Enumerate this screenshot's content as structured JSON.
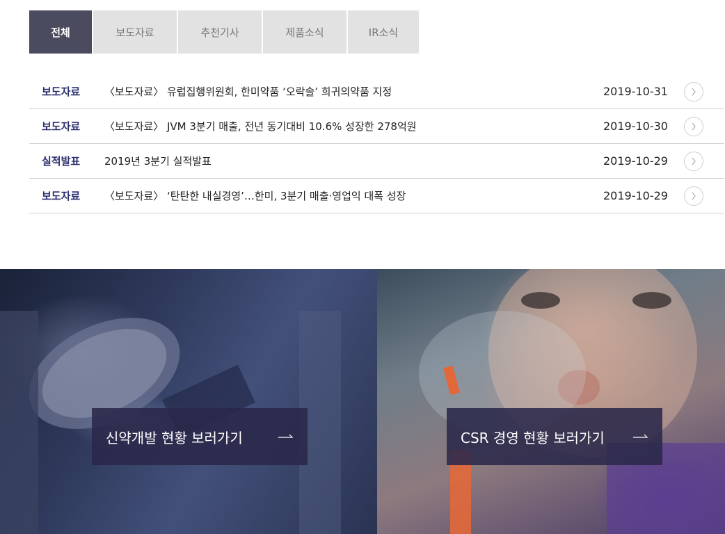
{
  "tabs": [
    {
      "label": "전체",
      "active": true
    },
    {
      "label": "보도자료",
      "active": false
    },
    {
      "label": "추천기사",
      "active": false
    },
    {
      "label": "제품소식",
      "active": false
    },
    {
      "label": "IR소식",
      "active": false
    }
  ],
  "news": [
    {
      "category": "보도자료",
      "title": "〈보도자료〉 유럽집행위원회, 한미약품 ‘오락솔’ 희귀의약품 지정",
      "date": "2019-10-31"
    },
    {
      "category": "보도자료",
      "title": "〈보도자료〉 JVM 3분기 매출, 전년 동기대비 10.6% 성장한 278억원",
      "date": "2019-10-30"
    },
    {
      "category": "실적발표",
      "title": "2019년 3분기 실적발표",
      "date": "2019-10-29"
    },
    {
      "category": "보도자료",
      "title": "〈보도자료〉 ‘탄탄한 내실경영’…한미, 3분기 매출·영업익 대폭 성장",
      "date": "2019-10-29"
    }
  ],
  "banners": {
    "left": {
      "label": "신약개발 현황 보러가기"
    },
    "right": {
      "label": "CSR 경영 현황 보러가기"
    }
  },
  "icons": {
    "row_arrow": "chevron-right-icon",
    "cta_arrow": "arrow-right-icon"
  },
  "colors": {
    "tab_active": "#4a4b5e",
    "category": "#2b2e6e",
    "cta_bg": "#2a284a"
  }
}
